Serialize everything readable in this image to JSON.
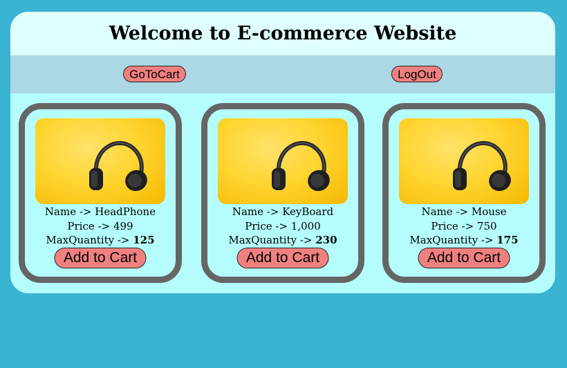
{
  "header": {
    "title": "Welcome to E-commerce Website"
  },
  "nav": {
    "cart_label": "GoToCart",
    "logout_label": "LogOut"
  },
  "labels": {
    "name": "Name -> ",
    "price": "Price -> ",
    "max_quantity": "MaxQuantity -> ",
    "add_to_cart": "Add to Cart"
  },
  "products": [
    {
      "name": "HeadPhone",
      "price": "499",
      "max_quantity": "125",
      "image_icon": "headphones-icon"
    },
    {
      "name": "KeyBoard",
      "price": "1,000",
      "max_quantity": "230",
      "image_icon": "headphones-icon"
    },
    {
      "name": "Mouse",
      "price": "750",
      "max_quantity": "175",
      "image_icon": "headphones-icon"
    }
  ],
  "colors": {
    "page_background": "#3bb3d3",
    "app_background": "#b5fdfd",
    "header_background": "#dffffe",
    "navbar_background": "#acd8e5",
    "button_color": "#f08080",
    "card_border": "#656565",
    "image_background": "#ffd531"
  }
}
